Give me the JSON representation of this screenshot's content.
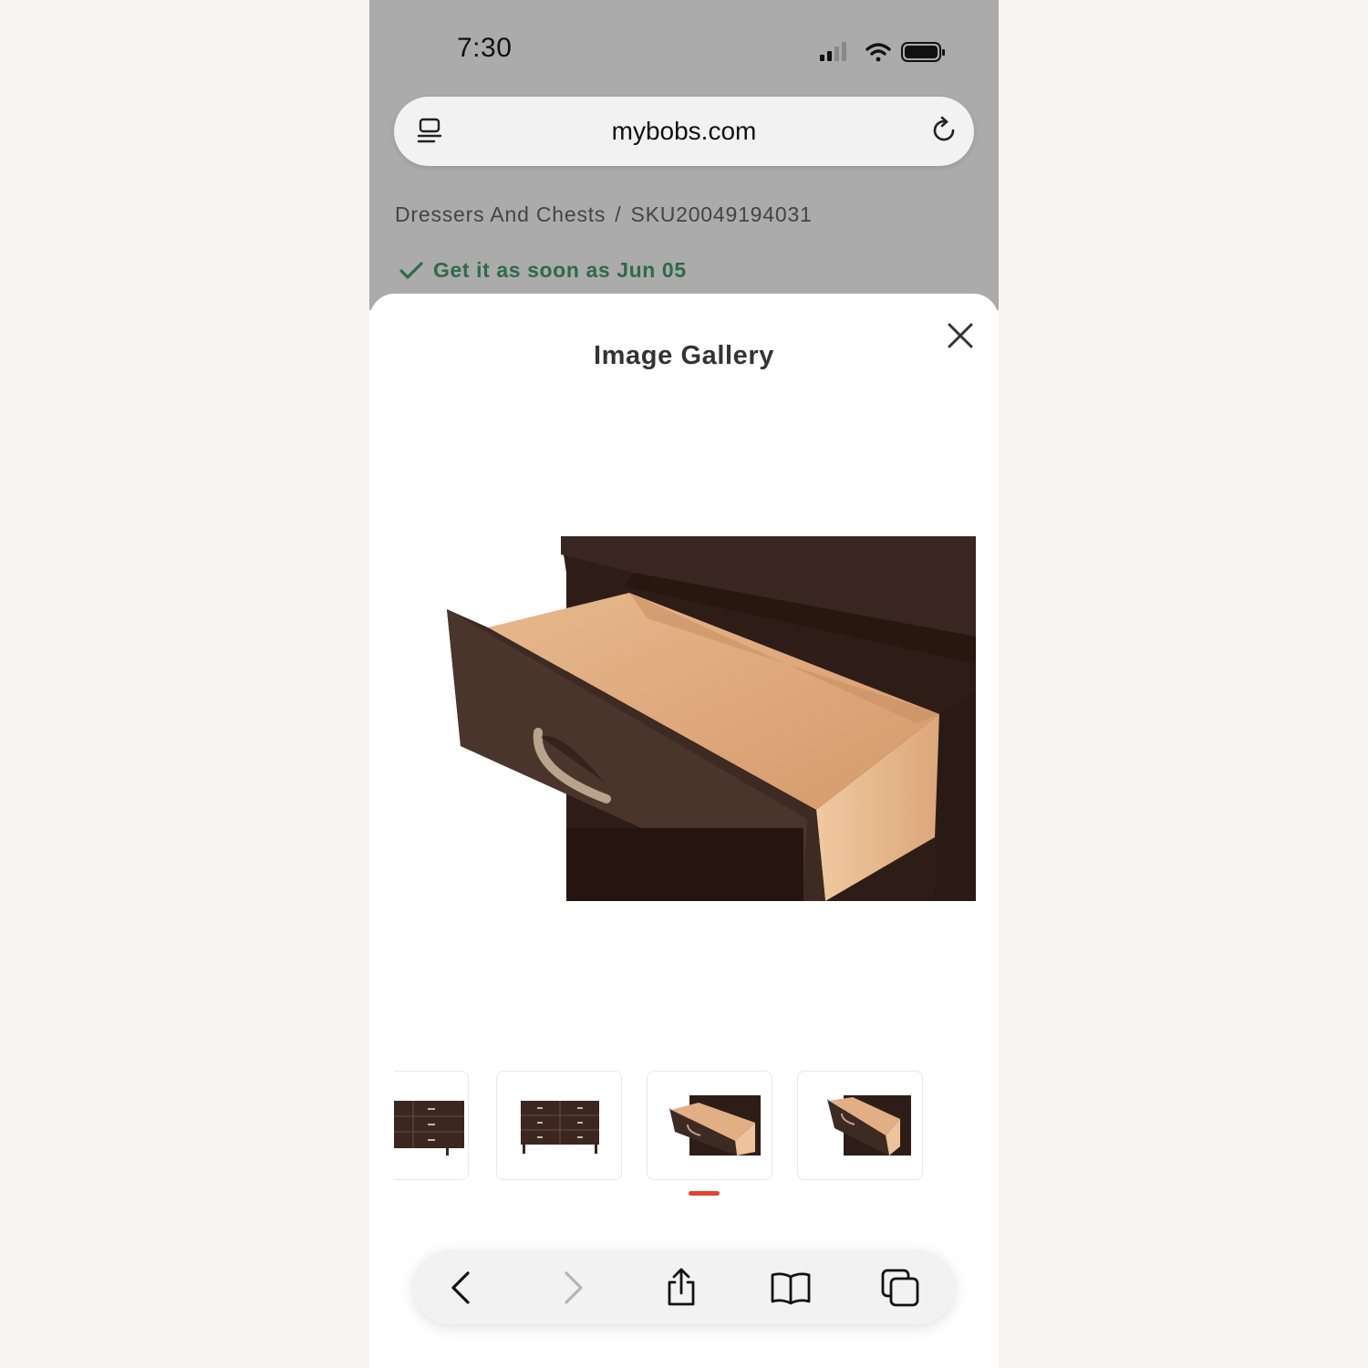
{
  "status_bar": {
    "time": "7:30"
  },
  "browser": {
    "url": "mybobs.com"
  },
  "breadcrumb": {
    "category": "Dressers And Chests",
    "separator": "/",
    "sku": "SKU20049194031"
  },
  "delivery": {
    "text": "Get it as soon as Jun 05",
    "color": "#2f6a47"
  },
  "gallery": {
    "title": "Image Gallery",
    "selected_index": 2,
    "indicator_color": "#e0452e",
    "thumbnails": [
      {
        "name": "dresser-partial"
      },
      {
        "name": "dresser-front"
      },
      {
        "name": "drawer-open-angle"
      },
      {
        "name": "drawer-open-close"
      }
    ]
  },
  "toolbar": {
    "icons": [
      "back-icon",
      "forward-icon",
      "share-icon",
      "bookmarks-icon",
      "tabs-icon"
    ]
  }
}
